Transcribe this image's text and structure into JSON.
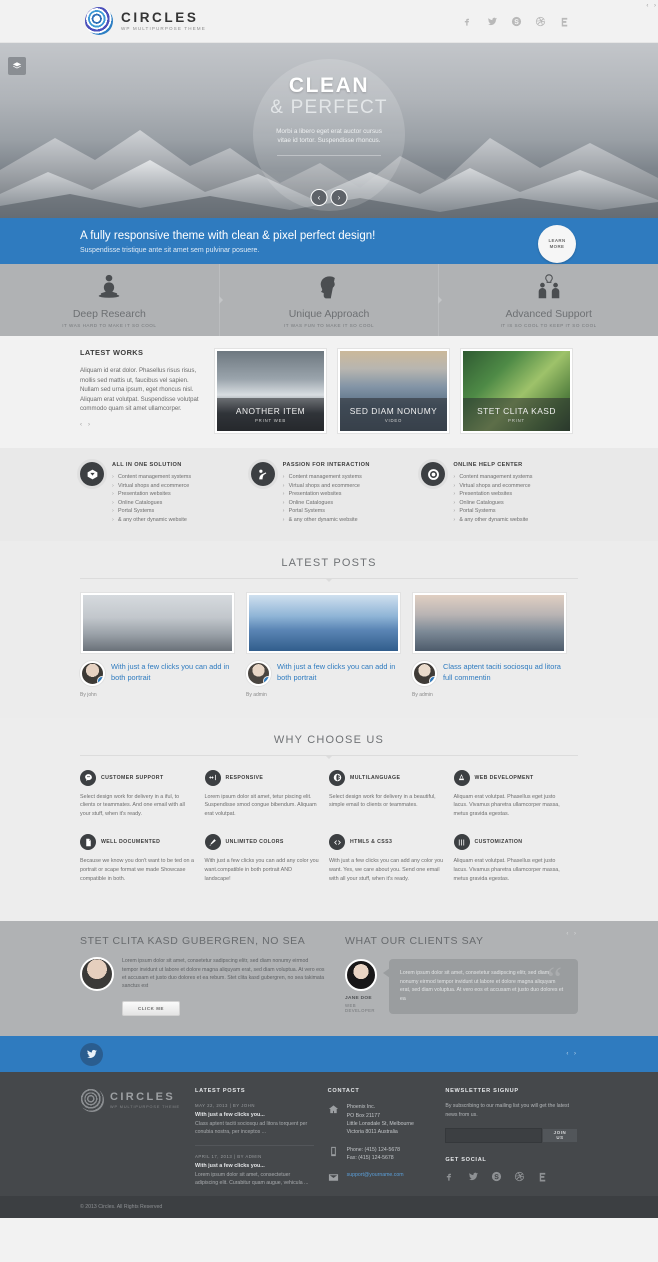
{
  "header": {
    "logo_name": "CIRCLES",
    "logo_sub": "WP MULTIPURPOSE THEME",
    "social": [
      "facebook-icon",
      "twitter-icon",
      "skype-icon",
      "dribbble-icon",
      "rss-icon"
    ]
  },
  "hero": {
    "title_line1": "CLEAN",
    "title_line2": "& PERFECT",
    "desc": "Morbi a libero eget erat auctor cursus vitae id tortor. Suspendisse rhoncus.",
    "prev": "‹",
    "next": "›"
  },
  "cta": {
    "title": "A fully responsive theme with clean & pixel perfect design!",
    "subtitle": "Suspendisse tristique ante sit amet sem pulvinar posuere.",
    "button_line1": "LEARN",
    "button_line2": "MORE"
  },
  "features3": [
    {
      "title": "Deep Research",
      "sub": "IT WAS HARD TO MAKE IT SO COOL",
      "icon": "meditation-icon"
    },
    {
      "title": "Unique Approach",
      "sub": "IT WAS FUN TO MAKE IT SO COOL",
      "icon": "head-gears-icon"
    },
    {
      "title": "Advanced Support",
      "sub": "IT IS SO COOL TO KEEP IT SO COOL",
      "icon": "people-idea-icon"
    }
  ],
  "works": {
    "heading": "LATEST WORKS",
    "paragraph": "Aliquam id erat dolor. Phasellus risus risus, mollis sed mattis ut, faucibus vel sapien. Nullam sed urna ipsum, eget rhoncus nisl. Aliquam erat volutpat. Suspendisse volutpat commodo quam sit amet ullamcorper.",
    "prev": "‹",
    "next": "›",
    "items": [
      {
        "title": "ANOTHER ITEM",
        "cat": "PRINT WEB"
      },
      {
        "title": "SED DIAM NONUMY",
        "cat": "VIDEO"
      },
      {
        "title": "STET CLITA KASD",
        "cat": "PRINT"
      }
    ]
  },
  "lists": [
    {
      "heading": "ALL IN ONE SOLUTION",
      "icon": "heart-box-icon",
      "items": [
        "Content management systems",
        "Virtual shops and ecommerce",
        "Presentation websites",
        "Online Catalogues",
        "Portal Systems",
        "& any other dynamic website"
      ]
    },
    {
      "heading": "PASSION FOR INTERACTION",
      "icon": "person-reach-icon",
      "items": [
        "Content management systems",
        "Virtual shops and ecommerce",
        "Presentation websites",
        "Online Catalogues",
        "Portal Systems",
        "& any other dynamic website"
      ]
    },
    {
      "heading": "ONLINE HELP CENTER",
      "icon": "lifebuoy-icon",
      "items": [
        "Content management systems",
        "Virtual shops and ecommerce",
        "Presentation websites",
        "Online Catalogues",
        "Portal Systems",
        "& any other dynamic website"
      ]
    }
  ],
  "posts_section": {
    "heading": "LATEST POSTS",
    "nav": "‹ ›",
    "posts": [
      {
        "title": "With just a few clicks you can add in both portrait",
        "by": "By john",
        "comments": "0"
      },
      {
        "title": "With just a few clicks you can add in both portrait",
        "by": "By admin",
        "comments": "2"
      },
      {
        "title": "Class aptent taciti sociosqu ad litora full commentin",
        "by": "By admin",
        "comments": "0"
      }
    ]
  },
  "why": {
    "heading": "WHY CHOOSE US",
    "items": [
      {
        "title": "CUSTOMER SUPPORT",
        "icon": "chat-circle-icon",
        "text": "Select design work for delivery in a iful, to clients or teammates. And one email with all your stuff, when it's ready."
      },
      {
        "title": "RESPONSIVE",
        "icon": "resize-icon",
        "text": "Lorem ipsum dolor sit amet, tetur piscing elit. Suspendisse smod congue bibendum. Aliquam erat volutpat."
      },
      {
        "title": "MULTILANGUAGE",
        "icon": "globe-icon",
        "text": "Select design work for delivery in a beautiful, simple email to clients or teammates."
      },
      {
        "title": "WEB DEVELOPMENT",
        "icon": "cone-icon",
        "text": "Aliquam erat volutpat. Phasellus eget justo lacus. Vivamus pharetra ullamcorper massa, metus gravida egestas."
      },
      {
        "title": "WELL DOCUMENTED",
        "icon": "document-icon",
        "text": "Because we know you don't want to be ted on a portrait or scape format we made Showcase compatible in both."
      },
      {
        "title": "UNLIMITED COLORS",
        "icon": "brush-icon",
        "text": "With just a few clicks you can add any color you want.compatible in both portrait AND landscape!"
      },
      {
        "title": "HTML5 & CSS3",
        "icon": "code-icon",
        "text": "With just a few clicks you can add any color you want. Yes, we care about you. Send one email with all your stuff, when it's ready."
      },
      {
        "title": "CUSTOMIZATION",
        "icon": "sliders-icon",
        "text": "Aliquam erat volutpat. Phasellus eget justo lacus. Vivamus pharetra ullamcorper massa, metus gravida egestas."
      }
    ]
  },
  "testimonials": {
    "left_heading": "STET CLITA KASD GUBERGREN, NO SEA",
    "left_text": "Lorem ipsum dolor sit amet, consetetur sadipscing elitr, sed diam nonumy eirmod tempor invidunt ut labore et dolore magna aliquyam erat, sed diam voluptua. At vero eos et accusam et justo duo dolores et ea rebum. Stet clita kasd gubergren, no sea takimata sanctus est",
    "left_button": "CLICK ME",
    "right_heading": "WHAT OUR CLIENTS SAY",
    "right_nav": "‹ ›",
    "quote": "Lorem ipsum dolor sit amet, consetetur sadipscing elitr, sed diam nonumy eirmod tempor invidunt ut labore et dolore magna aliquyam erat, sed diam voluptua. At vero eos et accusam et justo duo dolores et ea",
    "author": "JANE DOE",
    "author_role": "WEB DEVELOPER"
  },
  "twitter_bar": {
    "icon": "twitter-icon",
    "nav": "‹ ›"
  },
  "footer": {
    "logo_name": "CIRCLES",
    "logo_sub": "WP MULTIPURPOSE THEME",
    "latest_posts_heading": "LATEST POSTS",
    "latest_posts": [
      {
        "date": "MAY 22, 2013  |  BY JOHN",
        "title": "With just a few clicks you...",
        "excerpt": "Class aptent taciti sociosqu ad litora torquent per conubia nostra, per inceptos ..."
      },
      {
        "date": "APRIL 17, 2013  |  BY ADMIN",
        "title": "With just a few clicks you...",
        "excerpt": "Lorem ipsum dolor sit amet, consectetuer adipiscing elit. Curabitur quam augue, vehicula ..."
      }
    ],
    "contact_heading": "CONTACT",
    "address": "Phoenix Inc.\nPO Box 21177\nLittle Lonsdale St, Melbourne\nVictoria 8011 Australia",
    "phone": "Phone: (415) 124-5678\nFax: (415) 124-5678",
    "email": "support@yourname.com",
    "address_icon": "home-icon",
    "phone_icon": "phone-icon",
    "email_icon": "envelope-icon",
    "newsletter_heading": "NEWSLETTER SIGNUP",
    "newsletter_text": "By subscribing to our mailing list you will get the latest news from us.",
    "newsletter_placeholder": "",
    "newsletter_button": "JOIN US",
    "social_heading": "GET SOCIAL",
    "social": [
      "facebook-icon",
      "twitter-icon",
      "skype-icon",
      "dribbble-icon",
      "rss-icon"
    ],
    "copyright": "© 2013 Circles. All Rights Reserved"
  },
  "colors": {
    "accent": "#2f7bbf",
    "dark": "#3c3f42",
    "footer": "#45484b"
  }
}
